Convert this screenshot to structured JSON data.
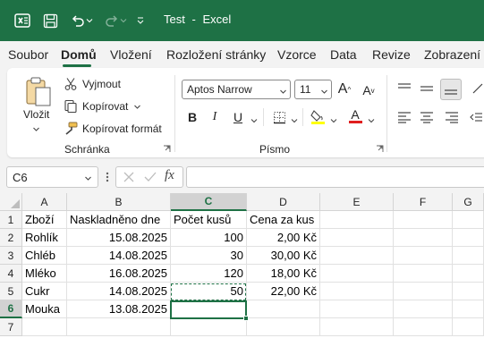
{
  "titlebar": {
    "doc_name": "Test",
    "separator": "-",
    "app_name": "Excel",
    "bg_color": "#1e7145"
  },
  "menu": {
    "tabs": [
      "Soubor",
      "Domů",
      "Vložení",
      "Rozložení stránky",
      "Vzorce",
      "Data",
      "Revize",
      "Zobrazení"
    ],
    "active_tab": "Domů"
  },
  "ribbon": {
    "clipboard": {
      "paste_label": "Vložit",
      "cut_label": "Vyjmout",
      "copy_label": "Kopírovat",
      "format_painter_label": "Kopírovat formát",
      "group_label": "Schránka"
    },
    "font": {
      "font_name": "Aptos Narrow",
      "font_size": "11",
      "bold": "B",
      "italic": "I",
      "underline": "U",
      "grow": "A",
      "shrink": "A",
      "font_color_label": "A",
      "group_label": "Písmo",
      "highlight_color": "#ffff00",
      "font_color": "#e01f1f"
    }
  },
  "formula_bar": {
    "name_box": "C6",
    "fx_label": "fx",
    "content": ""
  },
  "grid": {
    "columns": [
      "A",
      "B",
      "C",
      "D",
      "E",
      "F",
      "G"
    ],
    "rows": [
      "1",
      "2",
      "3",
      "4",
      "5",
      "6",
      "7"
    ],
    "selected_column": "C",
    "selected_row": "6",
    "cells": {
      "r1": [
        "Zboží",
        "Naskladněno dne",
        "Počet kusů",
        "Cena za kus"
      ],
      "r2": [
        "Rohlík",
        "15.08.2025",
        "100",
        "2,00 Kč"
      ],
      "r3": [
        "Chléb",
        "14.08.2025",
        "30",
        "30,00 Kč"
      ],
      "r4": [
        "Mléko",
        "16.08.2025",
        "120",
        "18,00 Kč"
      ],
      "r5": [
        "Cukr",
        "14.08.2025",
        "50",
        "22,00 Kč"
      ],
      "r6": [
        "Mouka",
        "13.08.2025",
        "",
        ""
      ]
    }
  }
}
